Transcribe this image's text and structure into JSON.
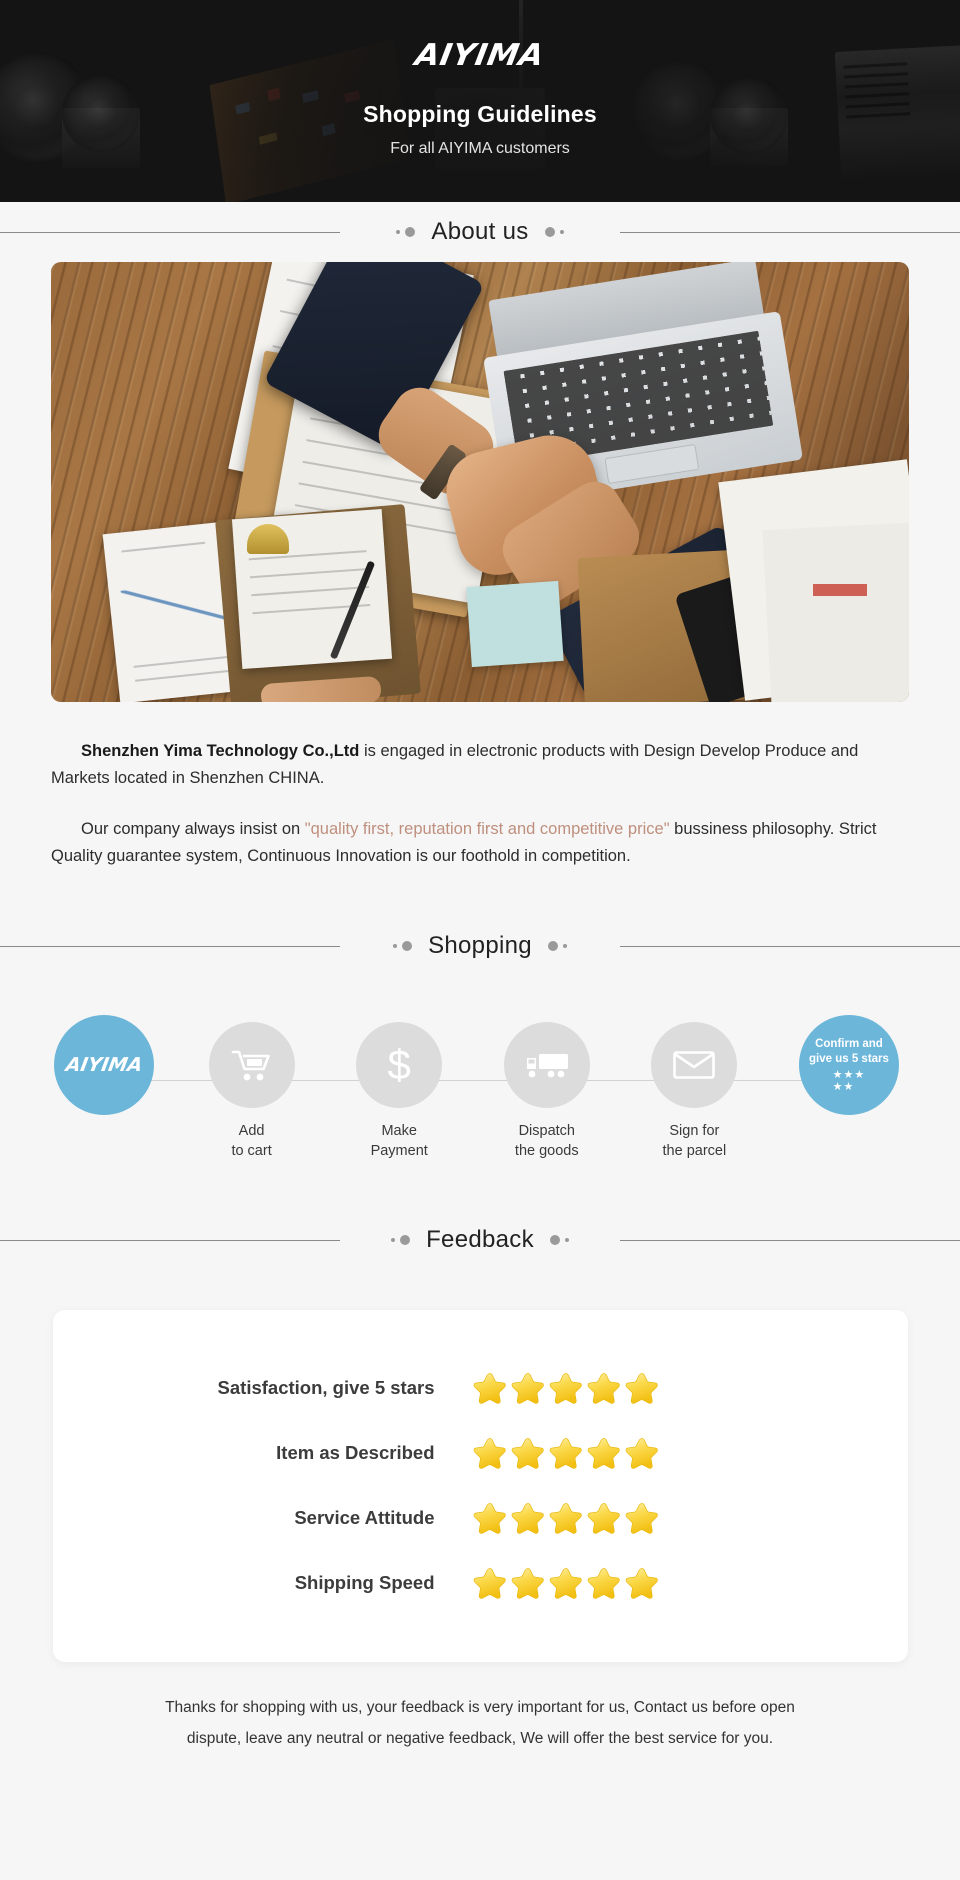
{
  "banner": {
    "logo": "AIYIMA",
    "title": "Shopping Guidelines",
    "subtitle": "For all AIYIMA customers"
  },
  "sections": {
    "about_heading": "About us",
    "shopping_heading": "Shopping",
    "feedback_heading": "Feedback"
  },
  "about": {
    "paragraph1_strong": "Shenzhen Yima Technology Co.,Ltd",
    "paragraph1_rest": " is engaged in electronic products with Design Develop Produce and Markets located in Shenzhen CHINA.",
    "paragraph2_pre": "Our company always insist on ",
    "paragraph2_quote": "\"quality first, reputation first and competitive price\"",
    "paragraph2_post": " bussiness philosophy. Strict Quality guarantee system, Continuous Innovation is our foothold in competition."
  },
  "shopping_steps": [
    {
      "icon": "aiyima-logo-icon",
      "brand": "AIYIMA",
      "label_line1": "",
      "label_line2": "",
      "style": "blue-brand"
    },
    {
      "icon": "shopping-cart-icon",
      "label_line1": "Add",
      "label_line2": "to cart",
      "style": "gray"
    },
    {
      "icon": "dollar-sign-icon",
      "label_line1": "Make",
      "label_line2": "Payment",
      "style": "gray"
    },
    {
      "icon": "delivery-truck-icon",
      "label_line1": "Dispatch",
      "label_line2": "the goods",
      "style": "gray"
    },
    {
      "icon": "envelope-icon",
      "label_line1": "Sign for",
      "label_line2": "the parcel",
      "style": "gray"
    },
    {
      "icon": "five-stars-icon",
      "circle_text_line1": "Confirm and",
      "circle_text_line2": "give us 5 stars",
      "style": "blue-rating"
    }
  ],
  "feedback_rows": [
    {
      "label": "Satisfaction, give 5 stars",
      "stars": 5
    },
    {
      "label": "Item as Described",
      "stars": 5
    },
    {
      "label": "Service Attitude",
      "stars": 5
    },
    {
      "label": "Shipping Speed",
      "stars": 5
    }
  ],
  "footer": {
    "line1": "Thanks for shopping with us, your feedback is very important for us, Contact us before open",
    "line2": "dispute, leave any neutral or negative feedback, We will offer the best service for you."
  },
  "colors": {
    "background": "#f6f6f6",
    "banner_bg": "#141414",
    "accent_blue": "#6cb6da",
    "circle_gray": "#dcdcdc",
    "quote_text": "#bf8f7d",
    "star_gold": "#f5c518"
  }
}
